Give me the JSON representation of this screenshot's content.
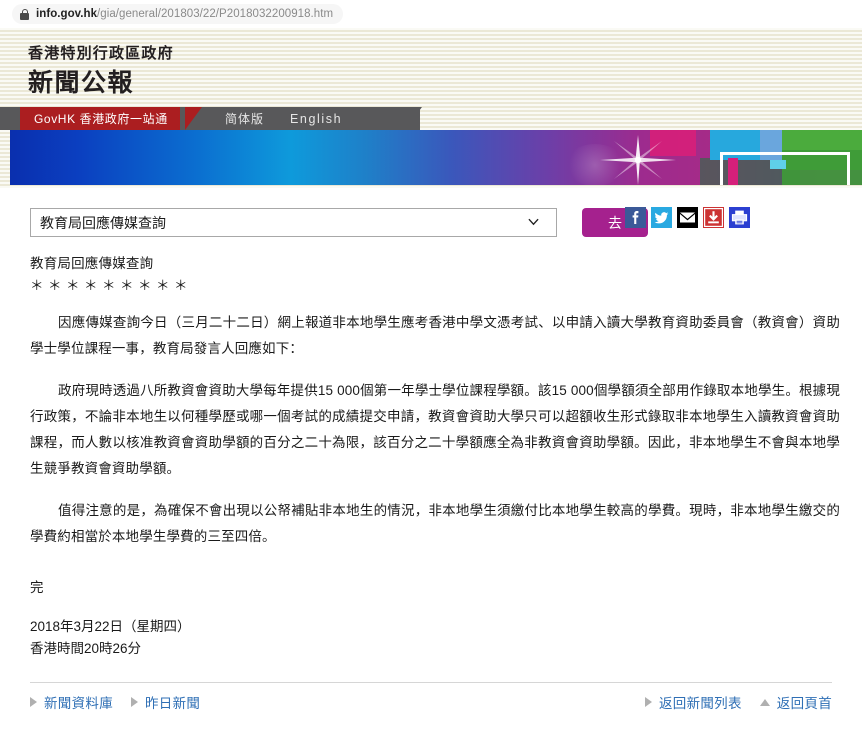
{
  "browser": {
    "lock_icon": "lock-icon",
    "url_host": "info.gov.hk",
    "url_path": "/gia/general/201803/22/P2018032200918.htm"
  },
  "header": {
    "gov_name": "香港特別行政區政府",
    "site_title": "新聞公報"
  },
  "topnav": {
    "govhk_tab": "GovHK 香港政府一站通",
    "simplified": "简体版",
    "english": "English"
  },
  "toolbar": {
    "selected_option": "教育局回應傳媒查詢",
    "options": [
      "教育局回應傳媒查詢"
    ],
    "go_label": "去",
    "share": [
      {
        "name": "facebook-share-icon",
        "color": "#3b5998"
      },
      {
        "name": "twitter-share-icon",
        "color": "#29a9e1"
      },
      {
        "name": "email-share-icon",
        "color": "#000000"
      },
      {
        "name": "save-download-icon",
        "color": "#cc3333"
      },
      {
        "name": "print-icon",
        "color": "#2b3fd1"
      }
    ]
  },
  "article": {
    "title": "教育局回應傳媒查詢",
    "stars": "＊＊＊＊＊＊＊＊＊",
    "paragraphs": [
      "因應傳媒查詢今日（三月二十二日）網上報道非本地學生應考香港中學文憑考試、以申請入讀大學教育資助委員會（教資會）資助學士學位課程一事，教育局發言人回應如下：",
      "政府現時透過八所教資會資助大學每年提供15 000個第一年學士學位課程學額。該15 000個學額須全部用作錄取本地學生。根據現行政策，不論非本地生以何種學歷或哪一個考試的成績提交申請，教資會資助大學只可以超額收生形式錄取非本地學生入讀教資會資助課程，而人數以核准教資會資助學額的百分之二十為限，該百分之二十學額應全為非教資會資助學額。因此，非本地學生不會與本地學生競爭教資會資助學額。",
      "值得注意的是，為確保不會出現以公帑補貼非本地生的情況，非本地學生須繳付比本地學生較高的學費。現時，非本地學生繳交的學費約相當於本地學生學費的三至四倍。"
    ],
    "end_mark": "完",
    "date_line": "2018年3月22日（星期四）",
    "time_line": "香港時間20時26分"
  },
  "footer": {
    "left_links": [
      {
        "label": "新聞資料庫",
        "marker": "triangle-right-icon"
      },
      {
        "label": "昨日新聞",
        "marker": "triangle-right-icon"
      }
    ],
    "right_links": [
      {
        "label": "返回新聞列表",
        "marker": "triangle-right-icon"
      },
      {
        "label": "返回頁首",
        "marker": "triangle-up-icon"
      }
    ]
  },
  "colors": {
    "govhk_red": "#ab1e20",
    "nav_grey": "#58585a",
    "cream": "#f3f1e4",
    "go_button": "#a5218e",
    "link_blue": "#2f6fb5"
  }
}
